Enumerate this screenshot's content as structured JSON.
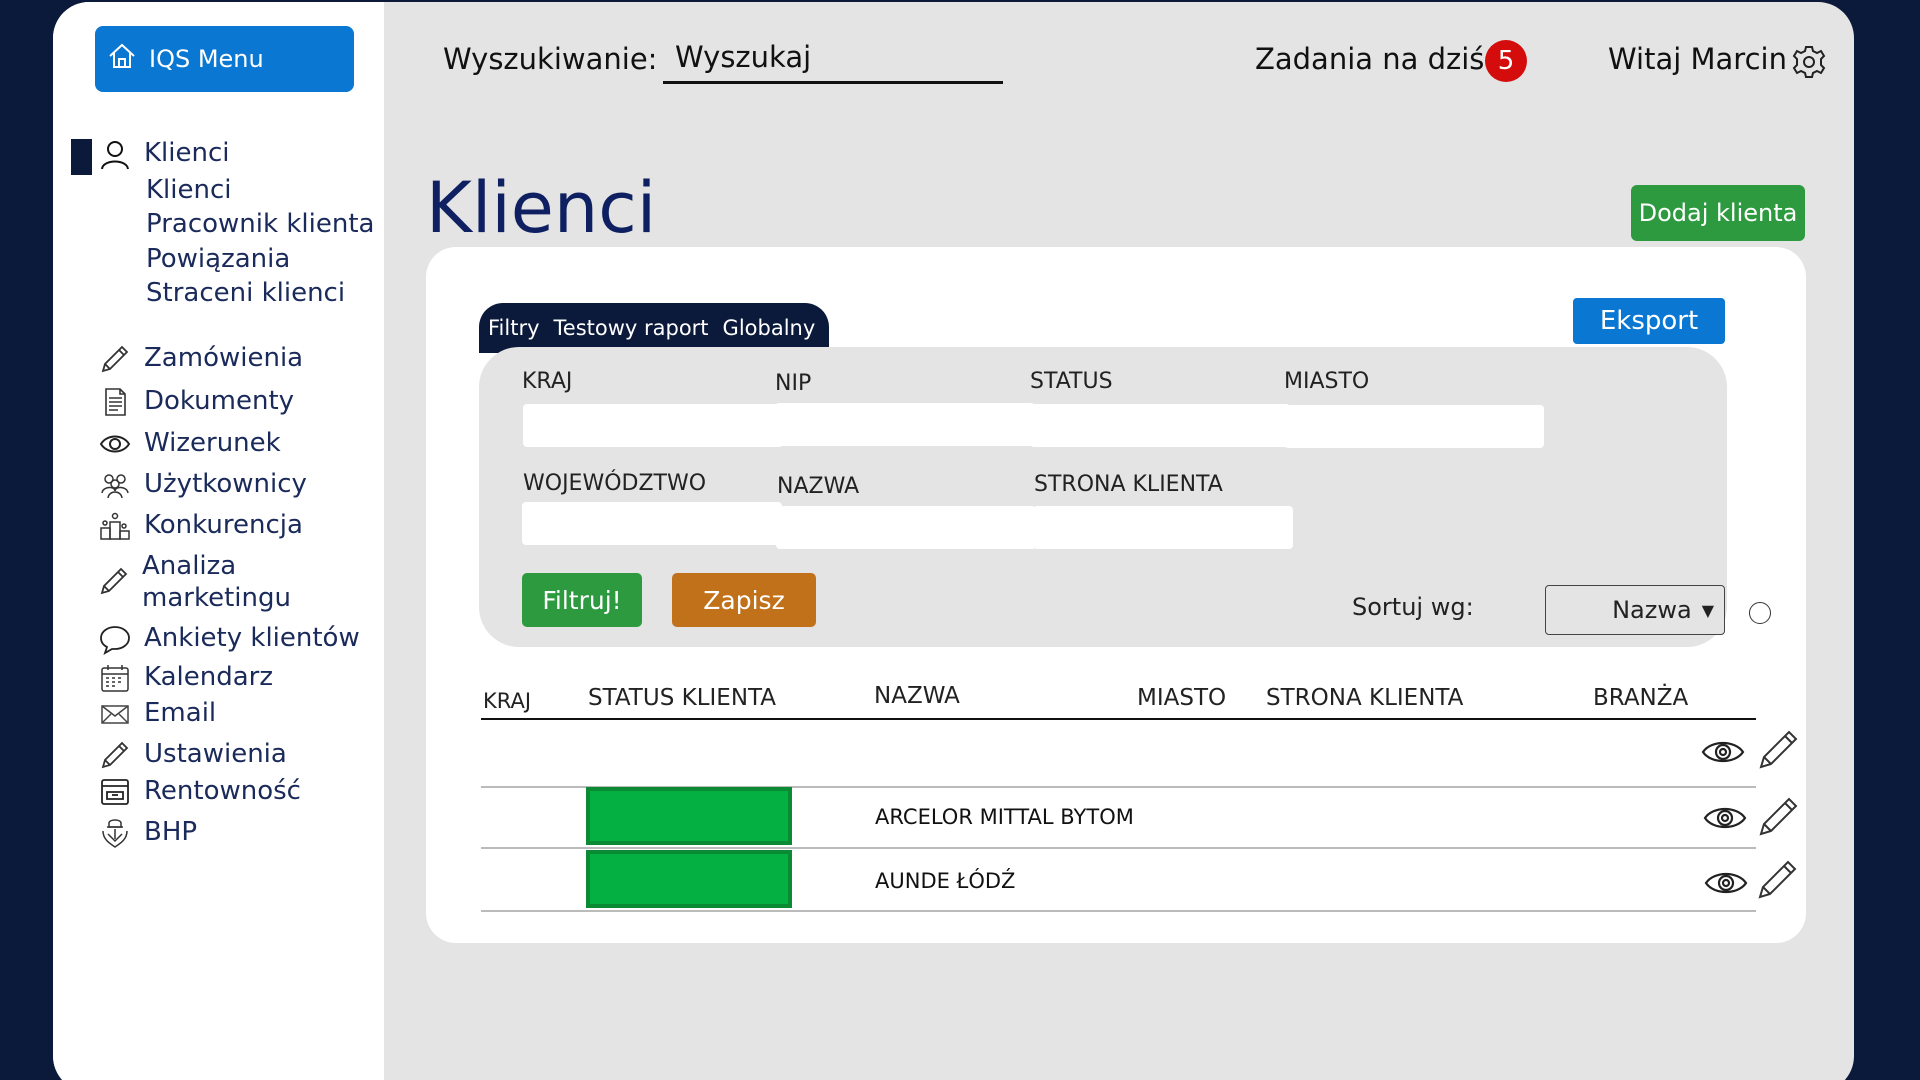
{
  "menu_button": {
    "label": "IQS Menu",
    "icon": "home-icon"
  },
  "sidebar": {
    "main_item": {
      "label": "Klienci",
      "icon": "user-icon"
    },
    "sub_items": [
      "Klienci",
      "Pracownik klienta",
      "Powiązania",
      "Straceni klienci"
    ],
    "items": [
      {
        "label": "Zamówienia",
        "icon": "pencil-icon"
      },
      {
        "label": "Dokumenty",
        "icon": "document-icon"
      },
      {
        "label": "Wizerunek",
        "icon": "eye-icon"
      },
      {
        "label": "Użytkownicy",
        "icon": "users-icon"
      },
      {
        "label": "Konkurencja",
        "icon": "podium-icon"
      },
      {
        "label": "Analiza marketingu",
        "icon": "pencil-icon"
      },
      {
        "label": "Ankiety klientów",
        "icon": "chat-bubble-icon"
      },
      {
        "label": "Kalendarz",
        "icon": "calendar-icon"
      },
      {
        "label": "Email",
        "icon": "envelope-icon"
      },
      {
        "label": "Ustawienia",
        "icon": "pencil-icon"
      },
      {
        "label": "Rentowność",
        "icon": "cash-register-icon"
      },
      {
        "label": "BHP",
        "icon": "safety-icon"
      }
    ]
  },
  "header": {
    "search_label": "Wyszukiwanie:",
    "search_value": "Wyszukaj",
    "tasks_label": "Zadania na dziś",
    "tasks_count": "5",
    "welcome": "Witaj Marcin"
  },
  "page": {
    "title": "Klienci",
    "add_button": "Dodaj klienta",
    "export_button": "Eksport"
  },
  "tabs": [
    "Filtry",
    "Testowy raport",
    "Globalny"
  ],
  "filters": {
    "labels": {
      "kraj": "KRAJ",
      "nip": "NIP",
      "status": "STATUS",
      "miasto": "MIASTO",
      "wojewodztwo": "WOJEWÓDZTWO",
      "nazwa": "NAZWA",
      "strona": "STRONA KLIENTA"
    },
    "filter_button": "Filtruj!",
    "save_button": "Zapisz",
    "sort_label": "Sortuj wg:",
    "sort_value": "Nazwa"
  },
  "table": {
    "columns": [
      "KRAJ",
      "STATUS KLIENTA",
      "NAZWA",
      "MIASTO",
      "STRONA KLIENTA",
      "BRANŻA"
    ],
    "rows": [
      {
        "kraj": "",
        "status_color": "",
        "nazwa": ""
      },
      {
        "kraj": "",
        "status_color": "#05b042",
        "nazwa": "ARCELOR MITTAL BYTOM"
      },
      {
        "kraj": "",
        "status_color": "#05b042",
        "nazwa": "AUNDE ŁÓDŹ"
      }
    ]
  },
  "colors": {
    "background": "#0b1a3a",
    "accent_blue": "#0a77d2",
    "green": "#2d9a3f",
    "orange": "#c1711a",
    "badge_red": "#d40c0c",
    "title_navy": "#0e2061"
  }
}
